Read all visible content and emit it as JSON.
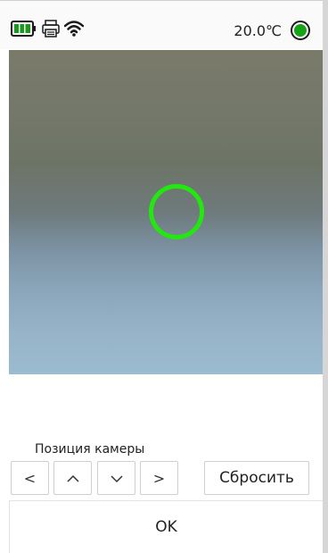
{
  "status_bar": {
    "icons": [
      "battery-icon",
      "printer-icon",
      "wifi-icon"
    ],
    "temperature": "20.0℃",
    "status_color": "#17a317"
  },
  "camera": {
    "target_color": "#22e80f"
  },
  "position_controls": {
    "label": "Позиция камеры",
    "left_label": "<",
    "up_icon": "chevron-up-icon",
    "down_icon": "chevron-down-icon",
    "right_label": ">",
    "reset_label": "Сбросить"
  },
  "footer": {
    "ok_label": "OK"
  }
}
